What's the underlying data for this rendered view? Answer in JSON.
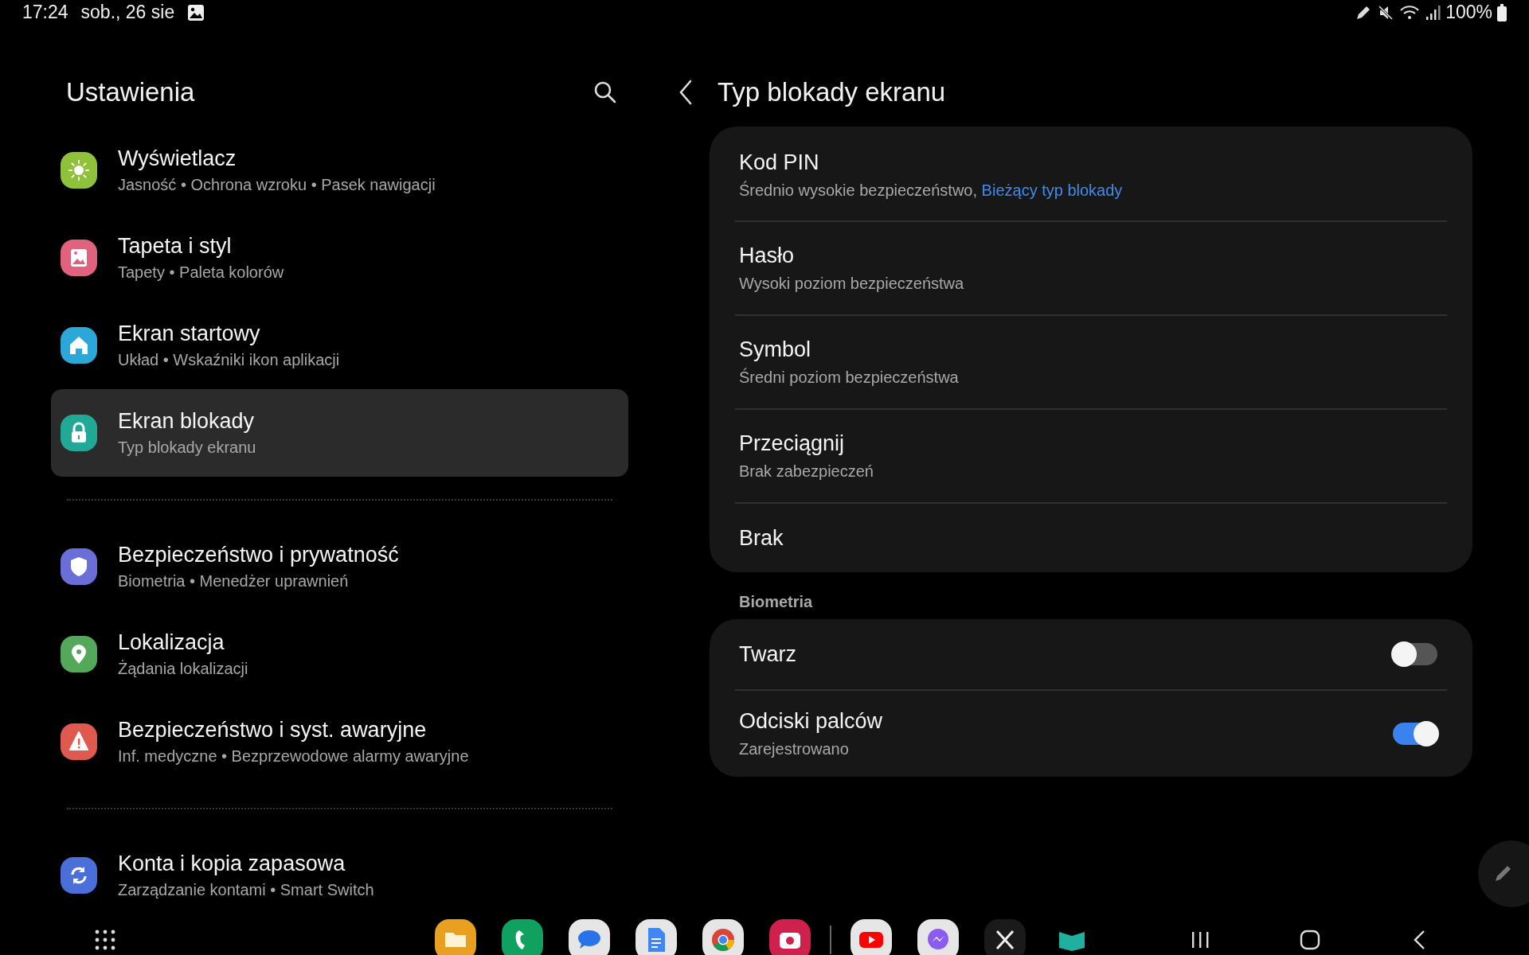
{
  "status_bar": {
    "time": "17:24",
    "date": "sob., 26 sie",
    "battery": "100%"
  },
  "sidebar": {
    "title": "Ustawienia",
    "groups": [
      {
        "items": [
          {
            "kind": "display",
            "color": "#8fc23a",
            "title": "Wyświetlacz",
            "subtitle": "Jasność  •  Ochrona wzroku  •  Pasek nawigacji",
            "selected": false
          },
          {
            "kind": "wallpaper",
            "color": "#e0627f",
            "title": "Tapeta i styl",
            "subtitle": "Tapety  •  Paleta kolorów",
            "selected": false
          },
          {
            "kind": "home",
            "color": "#2ba8d8",
            "title": "Ekran startowy",
            "subtitle": "Układ  •  Wskaźniki ikon aplikacji",
            "selected": false
          },
          {
            "kind": "lock",
            "color": "#21a896",
            "title": "Ekran blokady",
            "subtitle": "Typ blokady ekranu",
            "selected": true
          }
        ]
      },
      {
        "items": [
          {
            "kind": "shield",
            "color": "#6a6fd8",
            "title": "Bezpieczeństwo i prywatność",
            "subtitle": "Biometria  •  Menedżer uprawnień",
            "selected": false
          },
          {
            "kind": "location",
            "color": "#54a85a",
            "title": "Lokalizacja",
            "subtitle": "Żądania lokalizacji",
            "selected": false
          },
          {
            "kind": "alert",
            "color": "#e0594f",
            "title": "Bezpieczeństwo i syst. awaryjne",
            "subtitle": "Inf. medyczne  •  Bezprzewodowe alarmy awaryjne",
            "selected": false
          }
        ]
      },
      {
        "items": [
          {
            "kind": "sync",
            "color": "#4a6fd8",
            "title": "Konta i kopia zapasowa",
            "subtitle": "Zarządzanie kontami  •  Smart Switch",
            "selected": false
          }
        ]
      }
    ]
  },
  "detail": {
    "title": "Typ blokady ekranu",
    "lock_types": [
      {
        "title": "Kod PIN",
        "subtitle": "Średnio wysokie bezpieczeństwo,",
        "current_note": "Bieżący typ blokady"
      },
      {
        "title": "Hasło",
        "subtitle": "Wysoki poziom bezpieczeństwa"
      },
      {
        "title": "Symbol",
        "subtitle": "Średni poziom bezpieczeństwa"
      },
      {
        "title": "Przeciągnij",
        "subtitle": "Brak zabezpieczeń"
      },
      {
        "title": "Brak"
      }
    ],
    "biometrics": {
      "heading": "Biometria",
      "items": [
        {
          "title": "Twarz",
          "on": false
        },
        {
          "title": "Odciski palców",
          "subtitle": "Zarejestrowano",
          "on": true
        }
      ]
    }
  }
}
